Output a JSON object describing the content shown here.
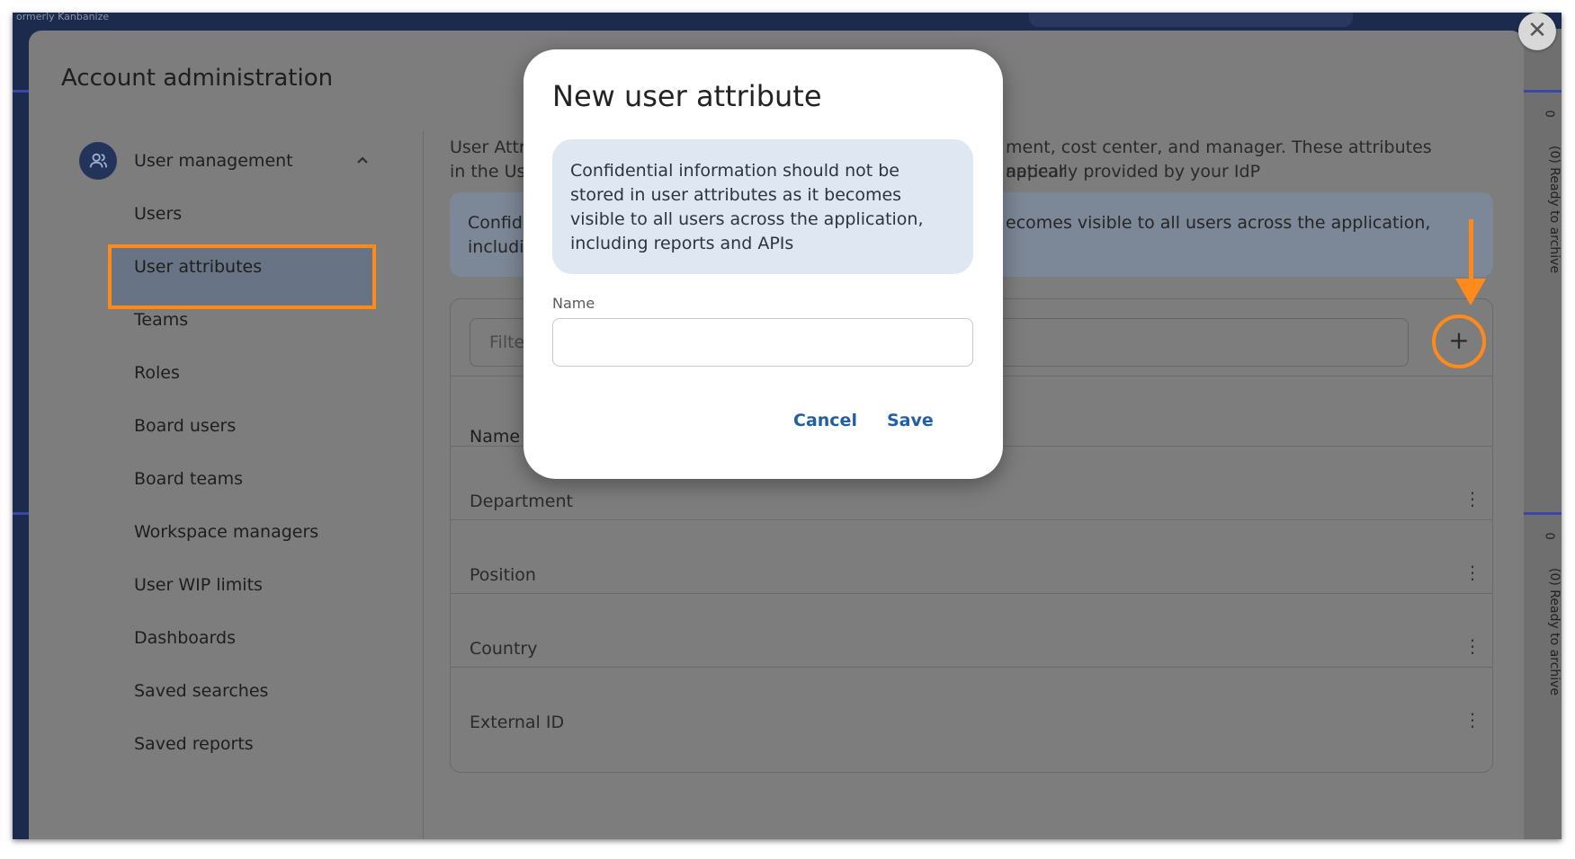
{
  "topbar": {
    "brand_text": "ormerly Kanbanize"
  },
  "right_strip": {
    "counters": [
      "0",
      "0"
    ],
    "labels": [
      "(0) Ready to archive",
      "(0) Ready to archive"
    ]
  },
  "panel": {
    "title": "Account administration",
    "close_icon": "close-icon"
  },
  "sidebar": {
    "section": {
      "label": "User management",
      "icon": "user-management-icon",
      "chevron": "chevron-up-icon"
    },
    "items": [
      {
        "label": "Users"
      },
      {
        "label": "User attributes",
        "active": true
      },
      {
        "label": "Teams"
      },
      {
        "label": "Roles"
      },
      {
        "label": "Board users"
      },
      {
        "label": "Board teams"
      },
      {
        "label": "Workspace managers"
      },
      {
        "label": "User WIP limits"
      },
      {
        "label": "Dashboards"
      },
      {
        "label": "Saved searches"
      },
      {
        "label": "Saved reports"
      }
    ]
  },
  "content": {
    "description_line1_left": "User Attribu",
    "description_line1_right": "ment, cost center, and manager. These attributes appear",
    "description_line2_left": "in the Users",
    "description_line2_right": "natically provided by your IdP",
    "alert_line1_left": "Confiden",
    "alert_line1_right": "ecomes visible to all users across the application,",
    "alert_line2_left": "including",
    "filter_placeholder": "Filter",
    "add_icon": "plus-icon",
    "table": {
      "header_name": "Name",
      "rows": [
        "Department",
        "Position",
        "Country",
        "External ID"
      ]
    }
  },
  "annotations": {
    "highlight_color": "#ff8a1c"
  },
  "modal": {
    "title": "New user attribute",
    "info": "Confidential information should not be stored in user attributes as it becomes visible to all users across the application, including reports and APIs",
    "name_label": "Name",
    "name_value": "",
    "cancel_label": "Cancel",
    "save_label": "Save"
  }
}
